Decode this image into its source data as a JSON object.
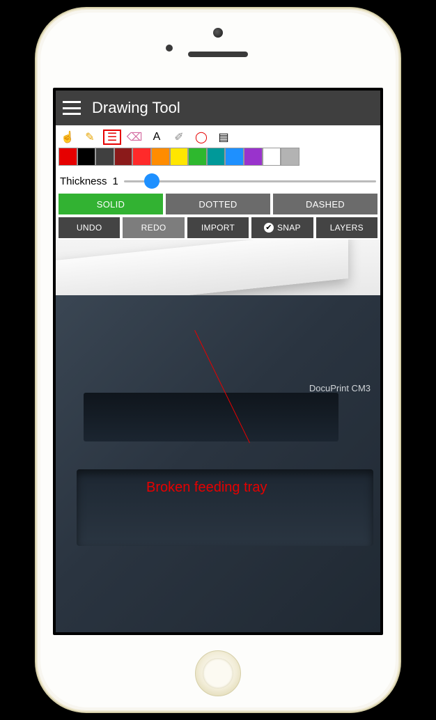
{
  "header": {
    "title": "Drawing Tool"
  },
  "tools": [
    {
      "name": "pointer-tool",
      "glyph": "☝"
    },
    {
      "name": "pencil-tool",
      "glyph": "✎"
    },
    {
      "name": "shape-tool",
      "glyph": "☰",
      "selected": true
    },
    {
      "name": "eraser-tool",
      "glyph": "⌫"
    },
    {
      "name": "text-tool",
      "glyph": "A"
    },
    {
      "name": "brush-tool",
      "glyph": "✐"
    },
    {
      "name": "circle-tool",
      "glyph": "◯"
    },
    {
      "name": "stamp-tool",
      "glyph": "▤"
    }
  ],
  "palette": [
    "#e60000",
    "#000000",
    "#404040",
    "#8b1a1a",
    "#ff2a2a",
    "#ff8c00",
    "#ffe600",
    "#2eb82e",
    "#009999",
    "#1e90ff",
    "#9933cc",
    "#ffffff",
    "#b3b3b3"
  ],
  "thickness": {
    "label": "Thickness",
    "value": "1"
  },
  "line_styles": {
    "solid": {
      "label": "SOLID",
      "active": true
    },
    "dotted": {
      "label": "DOTTED",
      "active": false
    },
    "dashed": {
      "label": "DASHED",
      "active": false
    }
  },
  "actions": {
    "undo": {
      "label": "UNDO"
    },
    "redo": {
      "label": "REDO"
    },
    "import": {
      "label": "IMPORT"
    },
    "snap": {
      "label": "SNAP",
      "checked": true
    },
    "layers": {
      "label": "LAYERS"
    }
  },
  "canvas": {
    "printer_label": "DocuPrint CM3",
    "annotation_text": "Broken feeding tray",
    "annotation_color": "#e60000"
  }
}
